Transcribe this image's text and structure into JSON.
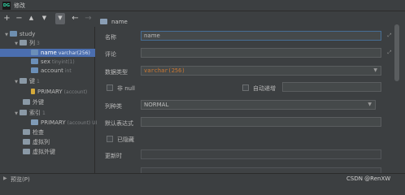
{
  "window": {
    "title": "修改",
    "app_badge": "DG"
  },
  "toolbar": {
    "add": "+",
    "remove": "−",
    "move_up": "▲",
    "move_down": "▼",
    "filter": "▼",
    "back": "←",
    "forward": "→"
  },
  "tree": {
    "schema": "study",
    "columns_folder": "列",
    "columns_count": "3",
    "columns": [
      {
        "name": "name",
        "type": "varchar(256)"
      },
      {
        "name": "sex",
        "type": "tinyint(1)"
      },
      {
        "name": "account",
        "type": "int"
      }
    ],
    "keys_folder": "键",
    "keys_count": "1",
    "primary_key": {
      "name": "PRIMARY",
      "detail": "(account)"
    },
    "foreign_keys_folder": "外键",
    "indexes_folder": "索引",
    "indexes_count": "1",
    "index": {
      "name": "PRIMARY",
      "detail": "(account) UI"
    },
    "checks_folder": "检查",
    "virtual_columns_folder": "虚拟列",
    "virtual_foreign_keys_folder": "虚拟外键"
  },
  "form": {
    "header": "name",
    "name_label": "名称",
    "name_value": "name",
    "comment_label": "评论",
    "comment_value": "",
    "datatype_label": "数据类型",
    "datatype_value": "varchar(256)",
    "not_null_label": "非 null",
    "auto_increment_label": "自动递增",
    "column_kind_label": "列种类",
    "column_kind_value": "NORMAL",
    "default_label": "默认表达式",
    "default_value": "",
    "hidden_label": "已隐藏",
    "on_update_label": "更新时",
    "on_update_value": ""
  },
  "bottom": {
    "preview_label": "预览(P)",
    "watermark": "CSDN @RenXW"
  }
}
